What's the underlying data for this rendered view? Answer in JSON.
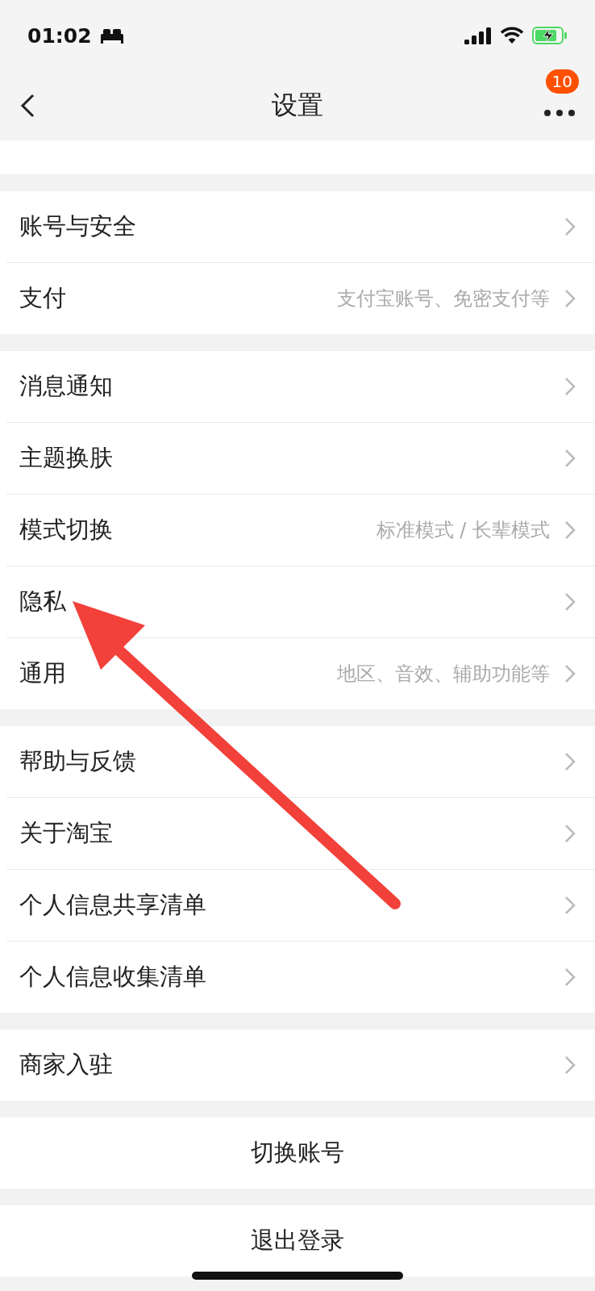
{
  "status_bar": {
    "time": "01:02"
  },
  "nav": {
    "title": "设置",
    "badge": "10"
  },
  "sections": [
    {
      "rows": [
        {
          "label": "账号与安全"
        },
        {
          "label": "支付",
          "detail": "支付宝账号、免密支付等"
        }
      ]
    },
    {
      "rows": [
        {
          "label": "消息通知"
        },
        {
          "label": "主题换肤"
        },
        {
          "label": "模式切换",
          "detail": "标准模式 / 长辈模式"
        },
        {
          "label": "隐私"
        },
        {
          "label": "通用",
          "detail": "地区、音效、辅助功能等"
        }
      ]
    },
    {
      "rows": [
        {
          "label": "帮助与反馈"
        },
        {
          "label": "关于淘宝"
        },
        {
          "label": "个人信息共享清单"
        },
        {
          "label": "个人信息收集清单"
        }
      ]
    },
    {
      "rows": [
        {
          "label": "商家入驻"
        }
      ]
    }
  ],
  "actions": [
    "切换账号",
    "退出登录"
  ]
}
